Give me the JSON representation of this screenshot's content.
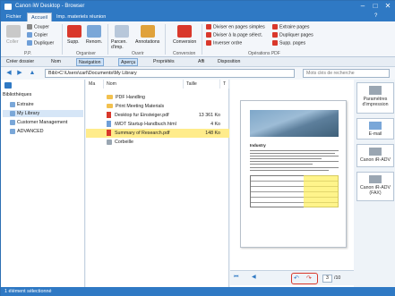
{
  "window": {
    "title": "Canon iW Desktop - Browser",
    "controls": [
      "–",
      "□",
      "✕"
    ]
  },
  "tabs": [
    "Fichier",
    "Accueil",
    "Imp. materiels réunion"
  ],
  "ribbon": {
    "coller": "Coller",
    "couper": "Couper",
    "copier": "Copier",
    "dupliquer": "Dupliquer",
    "group_pp": "P.P.",
    "supp": "Supp.",
    "renom": "Renom.",
    "group_organiser": "Organiser",
    "parcen": "Parcen. d'imp.",
    "annotations": "Annotations",
    "group_ouvrir": "Ouvrir",
    "conversion": "Conversion",
    "group_conversion": "Conversion",
    "diviser_simple": "Diviser en pages simples",
    "diviser_select": "Diviser à la page sélect.",
    "inverser": "Inverser ordre",
    "extraire_pages": "Extraire pages",
    "dupliquer_pages": "Dupliquer pages",
    "supp_pages": "Supp. pages",
    "group_pdf": "Opérations PDF"
  },
  "cmdbar": [
    "Créer dossier",
    "Nom",
    "Navigation",
    "Aperçu",
    "Propriétés",
    "Affi",
    "Disposition"
  ],
  "address": "Bibl>C:\\Users\\carl\\Documents\\My Library",
  "search_placeholder": "Mots clés de recherche",
  "tree": [
    "Bibliothèques",
    "Extraire",
    "My Library",
    "Customer Management",
    "ADVANCED"
  ],
  "columns": [
    "Ma",
    "Nom",
    "Taille",
    "T"
  ],
  "files": [
    {
      "name": "PDF Handling",
      "size": ""
    },
    {
      "name": "Print Meeting Materials",
      "size": ""
    },
    {
      "name": "Desktop fur Einsteiger.pdf",
      "size": "13 361 Ko"
    },
    {
      "name": "iWDT Startup Handbuch.html",
      "size": "4 Ko"
    },
    {
      "name": "Summary of Research.pdf",
      "size": "148 Ko"
    },
    {
      "name": "Corbeille",
      "size": ""
    }
  ],
  "preview": {
    "heading": "Industry",
    "page": "3",
    "total": "/10"
  },
  "destinations": [
    "Paramètres d'impression",
    "E-mail",
    "Canon iR-ADV",
    "Canon iR-ADV (FAX)"
  ],
  "status": "1 élément sélectionné"
}
